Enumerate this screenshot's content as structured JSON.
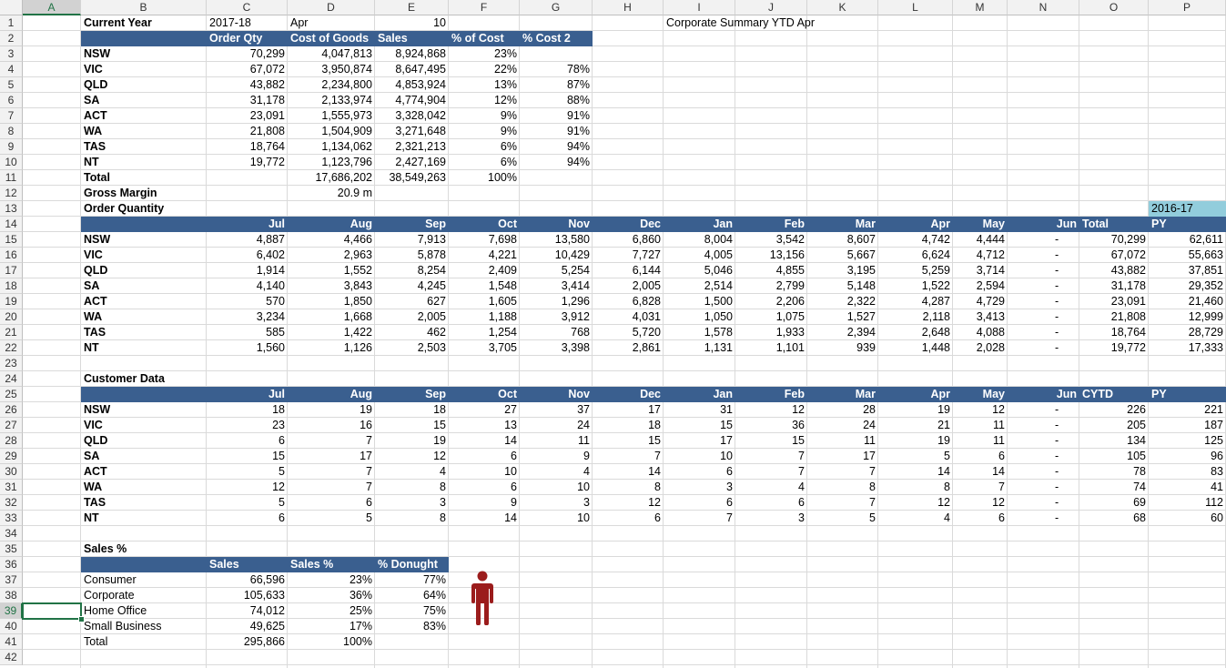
{
  "columns": [
    "A",
    "B",
    "C",
    "D",
    "E",
    "F",
    "G",
    "H",
    "I",
    "J",
    "K",
    "L",
    "M",
    "N",
    "O",
    "P"
  ],
  "rows": [
    "1",
    "2",
    "3",
    "4",
    "5",
    "6",
    "7",
    "8",
    "9",
    "10",
    "11",
    "12",
    "13",
    "14",
    "15",
    "16",
    "17",
    "18",
    "19",
    "20",
    "21",
    "22",
    "23",
    "24",
    "25",
    "26",
    "27",
    "28",
    "29",
    "30",
    "31",
    "32",
    "33",
    "34",
    "35",
    "36",
    "37",
    "38",
    "39",
    "40",
    "41",
    "42"
  ],
  "selected_cell": "A39",
  "header_band_color": "#3a5f8f",
  "py_fill_color": "#92cddc",
  "icon_color": "#9b1c1c",
  "top": {
    "current_year_label": "Current Year",
    "year": "2017-18",
    "month": "Apr",
    "month_num": "10",
    "corporate_summary": "Corporate Summary YTD Apr",
    "headers": [
      "Order Qty",
      "Cost of Goods",
      "Sales",
      "% of Cost",
      "% Cost 2"
    ],
    "rows": [
      {
        "region": "NSW",
        "qty": "70,299",
        "cogs": "4,047,813",
        "sales": "8,924,868",
        "pct": "23%",
        "pct2": ""
      },
      {
        "region": "VIC",
        "qty": "67,072",
        "cogs": "3,950,874",
        "sales": "8,647,495",
        "pct": "22%",
        "pct2": "78%"
      },
      {
        "region": "QLD",
        "qty": "43,882",
        "cogs": "2,234,800",
        "sales": "4,853,924",
        "pct": "13%",
        "pct2": "87%"
      },
      {
        "region": "SA",
        "qty": "31,178",
        "cogs": "2,133,974",
        "sales": "4,774,904",
        "pct": "12%",
        "pct2": "88%"
      },
      {
        "region": "ACT",
        "qty": "23,091",
        "cogs": "1,555,973",
        "sales": "3,328,042",
        "pct": "9%",
        "pct2": "91%"
      },
      {
        "region": "WA",
        "qty": "21,808",
        "cogs": "1,504,909",
        "sales": "3,271,648",
        "pct": "9%",
        "pct2": "91%"
      },
      {
        "region": "TAS",
        "qty": "18,764",
        "cogs": "1,134,062",
        "sales": "2,321,213",
        "pct": "6%",
        "pct2": "94%"
      },
      {
        "region": "NT",
        "qty": "19,772",
        "cogs": "1,123,796",
        "sales": "2,427,169",
        "pct": "6%",
        "pct2": "94%"
      }
    ],
    "total_label": "Total",
    "total_cogs": "17,686,202",
    "total_sales": "38,549,263",
    "total_pct": "100%",
    "gross_margin_label": "Gross Margin",
    "gross_margin": "20.9 m"
  },
  "order_qty": {
    "title": "Order Quantity",
    "py_year": "2016-17",
    "months": [
      "Jul",
      "Aug",
      "Sep",
      "Oct",
      "Nov",
      "Dec",
      "Jan",
      "Feb",
      "Mar",
      "Apr",
      "May",
      "Jun"
    ],
    "total_label": "Total",
    "py_label": "PY",
    "rows": [
      {
        "region": "NSW",
        "vals": [
          "4,887",
          "4,466",
          "7,913",
          "7,698",
          "13,580",
          "6,860",
          "8,004",
          "3,542",
          "8,607",
          "4,742",
          "4,444",
          "-"
        ],
        "total": "70,299",
        "py": "62,611"
      },
      {
        "region": "VIC",
        "vals": [
          "6,402",
          "2,963",
          "5,878",
          "4,221",
          "10,429",
          "7,727",
          "4,005",
          "13,156",
          "5,667",
          "6,624",
          "4,712",
          "-"
        ],
        "total": "67,072",
        "py": "55,663"
      },
      {
        "region": "QLD",
        "vals": [
          "1,914",
          "1,552",
          "8,254",
          "2,409",
          "5,254",
          "6,144",
          "5,046",
          "4,855",
          "3,195",
          "5,259",
          "3,714",
          "-"
        ],
        "total": "43,882",
        "py": "37,851"
      },
      {
        "region": "SA",
        "vals": [
          "4,140",
          "3,843",
          "4,245",
          "1,548",
          "3,414",
          "2,005",
          "2,514",
          "2,799",
          "5,148",
          "1,522",
          "2,594",
          "-"
        ],
        "total": "31,178",
        "py": "29,352"
      },
      {
        "region": "ACT",
        "vals": [
          "570",
          "1,850",
          "627",
          "1,605",
          "1,296",
          "6,828",
          "1,500",
          "2,206",
          "2,322",
          "4,287",
          "4,729",
          "-"
        ],
        "total": "23,091",
        "py": "21,460"
      },
      {
        "region": "WA",
        "vals": [
          "3,234",
          "1,668",
          "2,005",
          "1,188",
          "3,912",
          "4,031",
          "1,050",
          "1,075",
          "1,527",
          "2,118",
          "3,413",
          "-"
        ],
        "total": "21,808",
        "py": "12,999"
      },
      {
        "region": "TAS",
        "vals": [
          "585",
          "1,422",
          "462",
          "1,254",
          "768",
          "5,720",
          "1,578",
          "1,933",
          "2,394",
          "2,648",
          "4,088",
          "-"
        ],
        "total": "18,764",
        "py": "28,729"
      },
      {
        "region": "NT",
        "vals": [
          "1,560",
          "1,126",
          "2,503",
          "3,705",
          "3,398",
          "2,861",
          "1,131",
          "1,101",
          "939",
          "1,448",
          "2,028",
          "-"
        ],
        "total": "19,772",
        "py": "17,333"
      }
    ]
  },
  "customer": {
    "title": "Customer Data",
    "months": [
      "Jul",
      "Aug",
      "Sep",
      "Oct",
      "Nov",
      "Dec",
      "Jan",
      "Feb",
      "Mar",
      "Apr",
      "May",
      "Jun"
    ],
    "total_label": "CYTD",
    "py_label": "PY",
    "rows": [
      {
        "region": "NSW",
        "vals": [
          "18",
          "19",
          "18",
          "27",
          "37",
          "17",
          "31",
          "12",
          "28",
          "19",
          "12",
          "-"
        ],
        "total": "226",
        "py": "221"
      },
      {
        "region": "VIC",
        "vals": [
          "23",
          "16",
          "15",
          "13",
          "24",
          "18",
          "15",
          "36",
          "24",
          "21",
          "11",
          "-"
        ],
        "total": "205",
        "py": "187"
      },
      {
        "region": "QLD",
        "vals": [
          "6",
          "7",
          "19",
          "14",
          "11",
          "15",
          "17",
          "15",
          "11",
          "19",
          "11",
          "-"
        ],
        "total": "134",
        "py": "125"
      },
      {
        "region": "SA",
        "vals": [
          "15",
          "17",
          "12",
          "6",
          "9",
          "7",
          "10",
          "7",
          "17",
          "5",
          "6",
          "-"
        ],
        "total": "105",
        "py": "96"
      },
      {
        "region": "ACT",
        "vals": [
          "5",
          "7",
          "4",
          "10",
          "4",
          "14",
          "6",
          "7",
          "7",
          "14",
          "14",
          "-"
        ],
        "total": "78",
        "py": "83"
      },
      {
        "region": "WA",
        "vals": [
          "12",
          "7",
          "8",
          "6",
          "10",
          "8",
          "3",
          "4",
          "8",
          "8",
          "7",
          "-"
        ],
        "total": "74",
        "py": "41"
      },
      {
        "region": "TAS",
        "vals": [
          "5",
          "6",
          "3",
          "9",
          "3",
          "12",
          "6",
          "6",
          "7",
          "12",
          "12",
          "-"
        ],
        "total": "69",
        "py": "112"
      },
      {
        "region": "NT",
        "vals": [
          "6",
          "5",
          "8",
          "14",
          "10",
          "6",
          "7",
          "3",
          "5",
          "4",
          "6",
          "-"
        ],
        "total": "68",
        "py": "60"
      }
    ]
  },
  "sales_pct": {
    "title": "Sales %",
    "headers": [
      "Sales",
      "Sales %",
      "% Donught"
    ],
    "rows": [
      {
        "segment": "Consumer",
        "sales": "66,596",
        "pct": "23%",
        "donut": "77%"
      },
      {
        "segment": "Corporate",
        "sales": "105,633",
        "pct": "36%",
        "donut": "64%"
      },
      {
        "segment": "Home Office",
        "sales": "74,012",
        "pct": "25%",
        "donut": "75%"
      },
      {
        "segment": "Small Business",
        "sales": "49,625",
        "pct": "17%",
        "donut": "83%"
      }
    ],
    "total_label": "Total",
    "total_sales": "295,866",
    "total_pct": "100%"
  }
}
